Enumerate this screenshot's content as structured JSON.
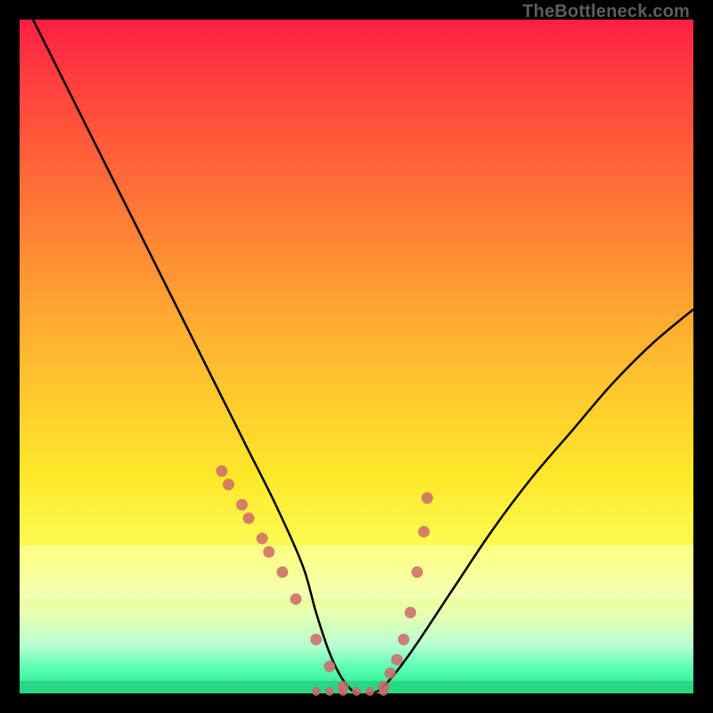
{
  "watermark": "TheBottleneck.com",
  "chart_data": {
    "type": "line",
    "title": "",
    "xlabel": "",
    "ylabel": "",
    "xlim": [
      0,
      100
    ],
    "ylim": [
      0,
      100
    ],
    "series": [
      {
        "name": "bottleneck-curve",
        "x": [
          2,
          6,
          10,
          14,
          18,
          22,
          26,
          30,
          34,
          38,
          42,
          44,
          46,
          48,
          50,
          52,
          54,
          58,
          64,
          70,
          76,
          82,
          88,
          94,
          100
        ],
        "y": [
          100,
          92,
          84,
          76,
          68,
          60,
          52,
          44,
          36,
          28,
          19,
          12,
          6,
          2,
          0,
          0,
          1,
          6,
          15,
          24,
          32,
          39,
          46,
          52,
          57
        ]
      }
    ],
    "markers": {
      "name": "highlight-points",
      "color": "#cc6a6a",
      "x": [
        30,
        31,
        33,
        34,
        36,
        37,
        39,
        41,
        44,
        46,
        48,
        54,
        55,
        56,
        57,
        58,
        59,
        60,
        60.5
      ],
      "y": [
        33,
        31,
        28,
        26,
        23,
        21,
        18,
        14,
        8,
        4,
        1,
        1,
        3,
        5,
        8,
        12,
        18,
        24,
        29
      ]
    },
    "bottom_markers": {
      "name": "optimal-range",
      "color": "#cc6a6a",
      "x": [
        44,
        46,
        48,
        50,
        52,
        54
      ],
      "y": [
        0.3,
        0.3,
        0.3,
        0.3,
        0.3,
        0.3
      ]
    }
  }
}
